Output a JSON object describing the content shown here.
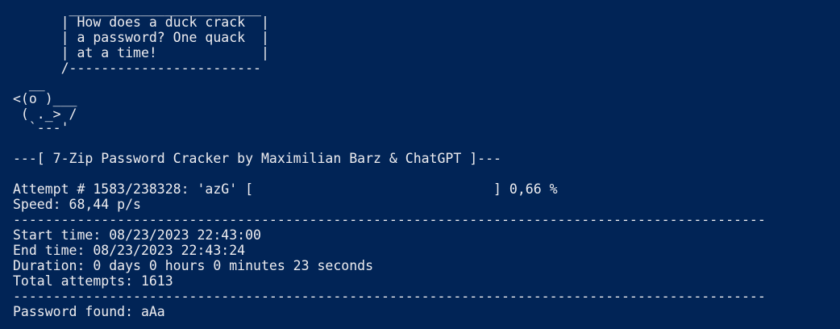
{
  "terminal": {
    "background": "#012456",
    "foreground": "#eeedf0",
    "lines": [
      "       ________________________",
      "      | How does a duck crack  |",
      "      | a password? One quack  |",
      "      | at a time!             |",
      "      /------------------------",
      "  __",
      "<(o )___",
      " ( ._> /",
      "  `---'",
      "",
      "---[ 7-Zip Password Cracker by Maximilian Barz & ChatGPT ]---",
      "",
      "Attempt # 1583/238328: 'azG' [                              ] 0,66 %",
      "Speed: 68,44 p/s",
      "----------------------------------------------------------------------------------------------",
      "Start time: 08/23/2023 22:43:00",
      "End time: 08/23/2023 22:43:24",
      "Duration: 0 days 0 hours 0 minutes 23 seconds",
      "Total attempts: 1613",
      "----------------------------------------------------------------------------------------------",
      "Password found: aAa"
    ]
  }
}
